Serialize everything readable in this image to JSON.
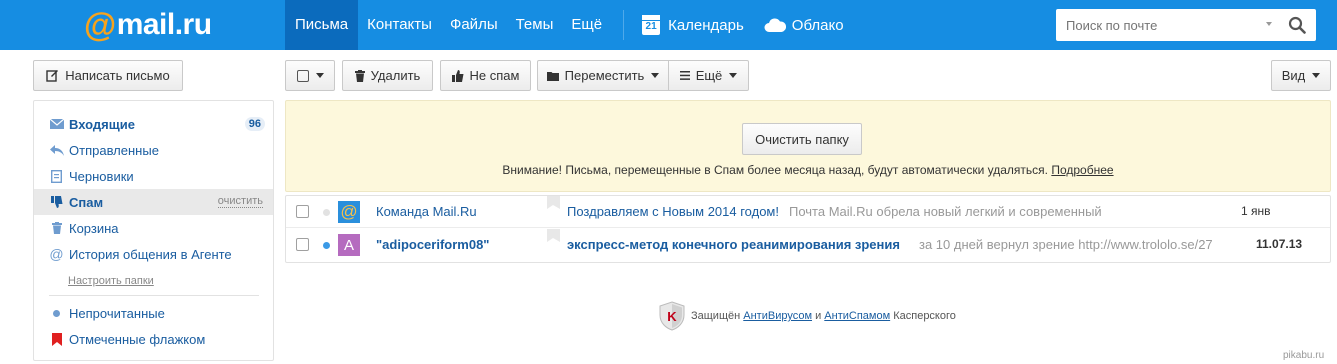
{
  "header": {
    "logo_at": "@",
    "logo_text": "mail.ru",
    "nav": [
      "Письма",
      "Контакты",
      "Файлы",
      "Темы",
      "Ещё"
    ],
    "calendar_day": "21",
    "calendar_label": "Календарь",
    "cloud_label": "Облако",
    "search_placeholder": "Поиск по почте"
  },
  "toolbar": {
    "compose_label": "Написать письмо",
    "delete_label": "Удалить",
    "not_spam_label": "Не спам",
    "move_label": "Переместить",
    "more_label": "Ещё",
    "view_label": "Вид"
  },
  "sidebar": {
    "inbox": {
      "label": "Входящие",
      "count": "96"
    },
    "sent": {
      "label": "Отправленные"
    },
    "drafts": {
      "label": "Черновики"
    },
    "spam": {
      "label": "Спам",
      "clear_label": "очистить"
    },
    "trash": {
      "label": "Корзина"
    },
    "agent": {
      "label": "История общения в Агенте"
    },
    "settings_link": "Настроить папки",
    "unread": {
      "label": "Непрочитанные"
    },
    "flagged": {
      "label": "Отмеченные флажком"
    }
  },
  "notice": {
    "clear_button": "Очистить папку",
    "text": "Внимание! Письма, перемещенные в Спам более месяца назад, будут автоматически удаляться.",
    "more_link": "Подробнее"
  },
  "messages": [
    {
      "avatar_char": "@",
      "sender": "Команда Mail.Ru",
      "subject": "Поздравляем с Новым 2014 годом!",
      "snippet": "Почта Mail.Ru обрела новый легкий и современный",
      "date": "1 янв",
      "unread": false
    },
    {
      "avatar_char": "A",
      "sender": "\"adipoceriform08\"",
      "subject": "экспресс-метод конечного реанимирования зрения",
      "snippet": "за 10 дней вернул зрение http://www.trololo.se/27",
      "date": "11.07.13",
      "unread": true
    }
  ],
  "footer": {
    "prefix": "Защищён",
    "antivirus": "АнтиВирусом",
    "and": "и",
    "antispam": "АнтиСпамом",
    "suffix": "Касперского"
  },
  "watermark": "pikabu.ru",
  "colors": {
    "topbar": "#168de2",
    "topbar_active": "#0b6bbd",
    "logo_at": "#f7a31c",
    "link": "#1a5da0",
    "notice_bg": "#fdf8dc",
    "avatar_mailru": "#2a8fdc",
    "avatar_a": "#b56bbf",
    "flagged_icon": "#e02020"
  }
}
